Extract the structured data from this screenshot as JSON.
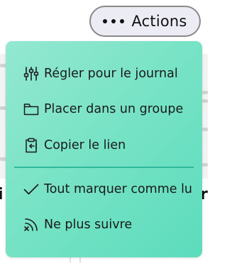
{
  "actions_button": {
    "label": "Actions"
  },
  "menu": {
    "items": [
      {
        "label": "Régler pour le journal",
        "icon": "sliders-icon"
      },
      {
        "label": "Placer dans un groupe",
        "icon": "folder-icon"
      },
      {
        "label": "Copier le lien",
        "icon": "clipboard-link-icon"
      },
      {
        "label": "Tout marquer comme lu",
        "icon": "checkmark-icon"
      },
      {
        "label": "Ne plus suivre",
        "icon": "unsubscribe-feed-icon"
      }
    ]
  },
  "colors": {
    "menu_gradient_start": "#93e8d1",
    "menu_gradient_end": "#5cdcbc",
    "divider": "#2fb99a",
    "button_background": "#ececf4",
    "button_border": "#8a8a8a"
  }
}
